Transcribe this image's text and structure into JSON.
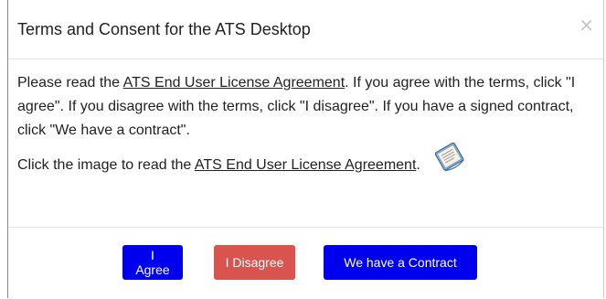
{
  "dialog": {
    "title": "Terms and Consent for the ATS Desktop",
    "close_glyph": "×",
    "body": {
      "p1_before": "Please read the ",
      "p1_link": "ATS End User License Agreement",
      "p1_after": ". If you agree with the terms, click \"I agree\". If you disagree with the terms, click \"I disagree\". If you have a signed contract, click \"We have a contract\".",
      "p2_before": "Click the image to read the ",
      "p2_link": "ATS End User License Agreement",
      "p2_after": ".",
      "icon": "document-book-icon"
    },
    "buttons": {
      "agree": "I Agree",
      "disagree": "I Disagree",
      "contract": "We have a Contract"
    },
    "colors": {
      "primary": "#0000ee",
      "danger": "#d9534f",
      "divider": "#e3e3e3"
    }
  }
}
